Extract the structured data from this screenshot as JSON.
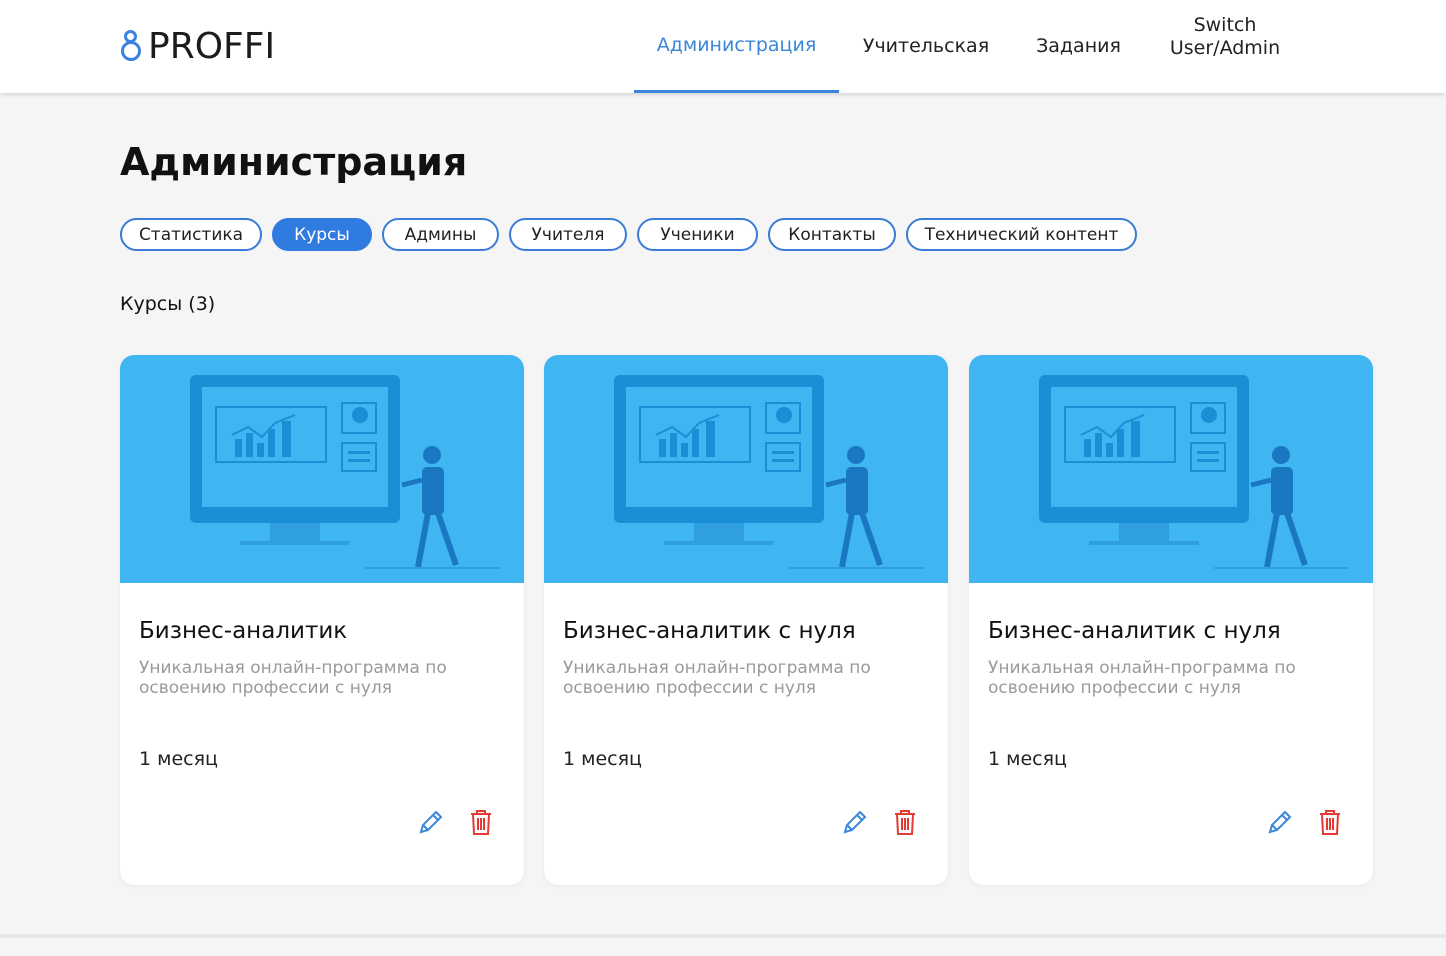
{
  "brand": {
    "logo_text": "PROFFI",
    "accent": "#3a86d8"
  },
  "nav": {
    "items": [
      {
        "label": "Администрация",
        "active": true
      },
      {
        "label": "Учительская",
        "active": false
      },
      {
        "label": "Задания",
        "active": false
      },
      {
        "label": "Switch User/Admin",
        "active": false
      }
    ]
  },
  "page": {
    "title": "Администрация"
  },
  "filters": [
    {
      "label": "Статистика",
      "active": false
    },
    {
      "label": "Курсы",
      "active": true
    },
    {
      "label": "Админы",
      "active": false
    },
    {
      "label": "Учителя",
      "active": false
    },
    {
      "label": "Ученики",
      "active": false
    },
    {
      "label": "Контакты",
      "active": false
    },
    {
      "label": "Технический контент",
      "active": false
    }
  ],
  "section": {
    "title": "Курсы (3)"
  },
  "courses": [
    {
      "title": "Бизнес-аналитик",
      "description": "Уникальная онлайн-программа по освоению профессии с нуля",
      "duration": "1 месяц",
      "edit_icon": "pencil-icon",
      "delete_icon": "trash-icon"
    },
    {
      "title": "Бизнес-аналитик с нуля",
      "description": "Уникальная онлайн-программа по освоению профессии с нуля",
      "duration": "1 месяц",
      "edit_icon": "pencil-icon",
      "delete_icon": "trash-icon"
    },
    {
      "title": "Бизнес-аналитик с нуля",
      "description": "Уникальная онлайн-программа по освоению профессии с нуля",
      "duration": "1 месяц",
      "edit_icon": "pencil-icon",
      "delete_icon": "trash-icon"
    }
  ],
  "colors": {
    "card_image_bg": "#3fb6f2",
    "edit_icon": "#3a86d8",
    "delete_icon": "#e53935"
  }
}
